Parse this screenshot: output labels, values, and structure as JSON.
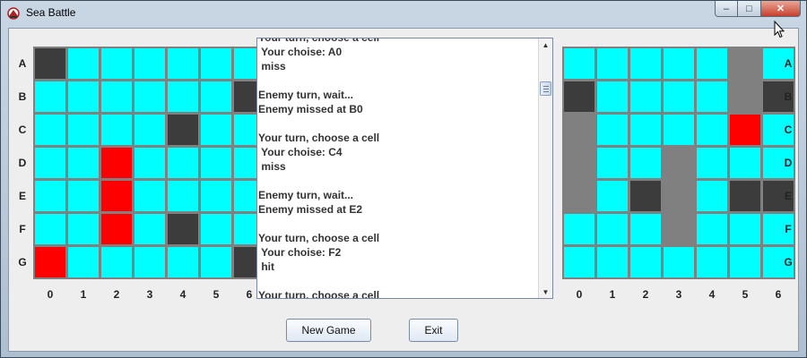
{
  "window": {
    "title": "Sea Battle",
    "controls": {
      "minimize": "–",
      "maximize": "□",
      "close": "✕"
    }
  },
  "rows": [
    "A",
    "B",
    "C",
    "D",
    "E",
    "F",
    "G"
  ],
  "cols": [
    "0",
    "1",
    "2",
    "3",
    "4",
    "5",
    "6"
  ],
  "colors": {
    "water": "#00ffff",
    "ship": "#3c3c3c",
    "hit": "#ff0000",
    "sunk": "#808080"
  },
  "player_board": {
    "cells": [
      [
        "ship",
        "water",
        "water",
        "water",
        "water",
        "water",
        "water"
      ],
      [
        "water",
        "water",
        "water",
        "water",
        "water",
        "water",
        "ship"
      ],
      [
        "water",
        "water",
        "water",
        "water",
        "ship",
        "water",
        "water"
      ],
      [
        "water",
        "water",
        "hit",
        "water",
        "water",
        "water",
        "water"
      ],
      [
        "water",
        "water",
        "hit",
        "water",
        "water",
        "water",
        "water"
      ],
      [
        "water",
        "water",
        "hit",
        "water",
        "ship",
        "water",
        "water"
      ],
      [
        "hit",
        "water",
        "water",
        "water",
        "water",
        "water",
        "ship"
      ]
    ]
  },
  "enemy_board": {
    "cells": [
      [
        "water",
        "water",
        "water",
        "water",
        "water",
        "sunk",
        "water"
      ],
      [
        "ship",
        "water",
        "water",
        "water",
        "water",
        "sunk",
        "ship"
      ],
      [
        "sunk",
        "water",
        "water",
        "water",
        "water",
        "hit",
        "water"
      ],
      [
        "sunk",
        "water",
        "water",
        "sunk",
        "water",
        "water",
        "water"
      ],
      [
        "sunk",
        "water",
        "ship",
        "sunk",
        "water",
        "ship",
        "ship"
      ],
      [
        "water",
        "water",
        "water",
        "sunk",
        "water",
        "water",
        "water"
      ],
      [
        "water",
        "water",
        "water",
        "water",
        "water",
        "water",
        "water"
      ]
    ]
  },
  "log": {
    "lines": [
      "Your turn, choose a cell",
      " Your choise: A0",
      " miss",
      "",
      "Enemy turn, wait...",
      "Enemy missed at B0",
      "",
      "Your turn, choose a cell",
      " Your choise: C4",
      " miss",
      "",
      "Enemy turn, wait...",
      "Enemy missed at E2",
      "",
      "Your turn, choose a cell",
      " Your choise: F2",
      " hit",
      "",
      "Your turn, choose a cell"
    ]
  },
  "buttons": {
    "new_game": "New Game",
    "exit": "Exit"
  }
}
